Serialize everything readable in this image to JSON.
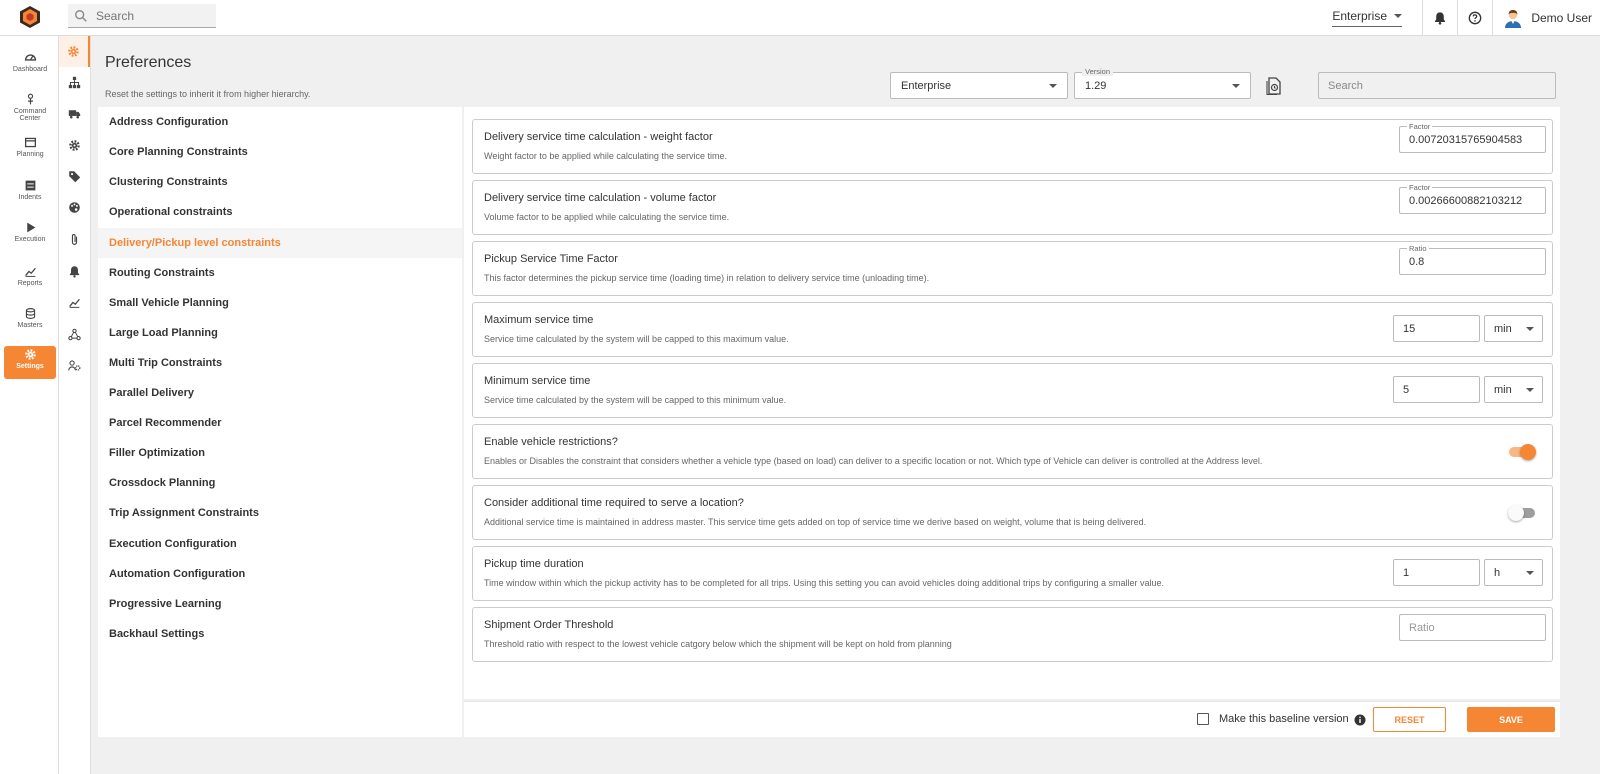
{
  "colors": {
    "accent": "#f58634",
    "accent_light": "#fdf0e6",
    "text": "#333333"
  },
  "topbar": {
    "search_placeholder": "Search",
    "org_selector": "Enterprise",
    "user_name": "Demo User"
  },
  "leftnav": {
    "items": [
      {
        "label": "Dashboard",
        "icon": "dashboard-icon"
      },
      {
        "label": "Command Center",
        "icon": "command-center-icon"
      },
      {
        "label": "Planning",
        "icon": "planning-icon"
      },
      {
        "label": "Indents",
        "icon": "indents-icon"
      },
      {
        "label": "Execution",
        "icon": "execution-icon"
      },
      {
        "label": "Reports",
        "icon": "reports-icon"
      },
      {
        "label": "Masters",
        "icon": "masters-icon"
      },
      {
        "label": "Settings",
        "icon": "settings-icon",
        "active": true
      }
    ]
  },
  "subnav": {
    "icons": [
      "gear-icon",
      "hierarchy-icon",
      "truck-icon",
      "cog-icon",
      "tag-icon",
      "palette-icon",
      "paperclip-icon",
      "bell-icon",
      "chart-icon",
      "network-icon",
      "user-settings-icon"
    ]
  },
  "header": {
    "title": "Preferences",
    "subtitle": "Reset the settings to inherit it from higher hierarchy.",
    "scope_select": "Enterprise",
    "version_label": "Version",
    "version_value": "1.29",
    "search_placeholder": "Search"
  },
  "categories": [
    "Address Configuration",
    "Core Planning Constraints",
    "Clustering Constraints",
    "Operational constraints",
    "Delivery/Pickup level constraints",
    "Routing Constraints",
    "Small Vehicle Planning",
    "Large Load Planning",
    "Multi Trip Constraints",
    "Parallel Delivery",
    "Parcel Recommender",
    "Filler Optimization",
    "Crossdock Planning",
    "Trip Assignment Constraints",
    "Execution Configuration",
    "Automation Configuration",
    "Progressive Learning",
    "Backhaul Settings"
  ],
  "active_category_index": 4,
  "settings": [
    {
      "title": "Delivery service time calculation - weight factor",
      "desc": "Weight factor to be applied while calculating the service time.",
      "type": "field",
      "label": "Factor",
      "value": "0.00720315765904583"
    },
    {
      "title": "Delivery service time calculation - volume factor",
      "desc": "Volume factor to be applied while calculating the service time.",
      "type": "field",
      "label": "Factor",
      "value": "0.00266600882103212"
    },
    {
      "title": "Pickup Service Time Factor",
      "desc": "This factor determines the pickup service time (loading time) in relation to delivery service time (unloading time).",
      "type": "field",
      "label": "Ratio",
      "value": "0.8"
    },
    {
      "title": "Maximum service time",
      "desc": "Service time calculated by the system will be capped to this maximum value.",
      "type": "unit",
      "value": "15",
      "unit": "min"
    },
    {
      "title": "Minimum service time",
      "desc": "Service time calculated by the system will be capped to this minimum value.",
      "type": "unit",
      "value": "5",
      "unit": "min"
    },
    {
      "title": "Enable vehicle restrictions?",
      "desc": "Enables or Disables the constraint that considers whether a vehicle type (based on load) can deliver to a specific location or not. Which type of Vehicle can deliver is controlled at the Address level.",
      "type": "toggle",
      "on": true
    },
    {
      "title": "Consider additional time required to serve a location?",
      "desc": "Additional service time is maintained in address master. This service time gets added on top of service time we derive based on weight, volume that is being delivered.",
      "type": "toggle",
      "on": false
    },
    {
      "title": "Pickup time duration",
      "desc": "Time window within which the pickup activity has to be completed for all trips. Using this setting you can avoid vehicles doing additional trips by configuring a smaller value.",
      "type": "unit",
      "value": "1",
      "unit": "h"
    },
    {
      "title": "Shipment Order Threshold",
      "desc": "Threshold ratio with respect to the lowest vehicle catgory below which the shipment will be kept on hold from planning",
      "type": "placeholder",
      "placeholder": "Ratio"
    }
  ],
  "footer": {
    "baseline_label": "Make this baseline version",
    "reset_label": "RESET",
    "save_label": "SAVE"
  }
}
